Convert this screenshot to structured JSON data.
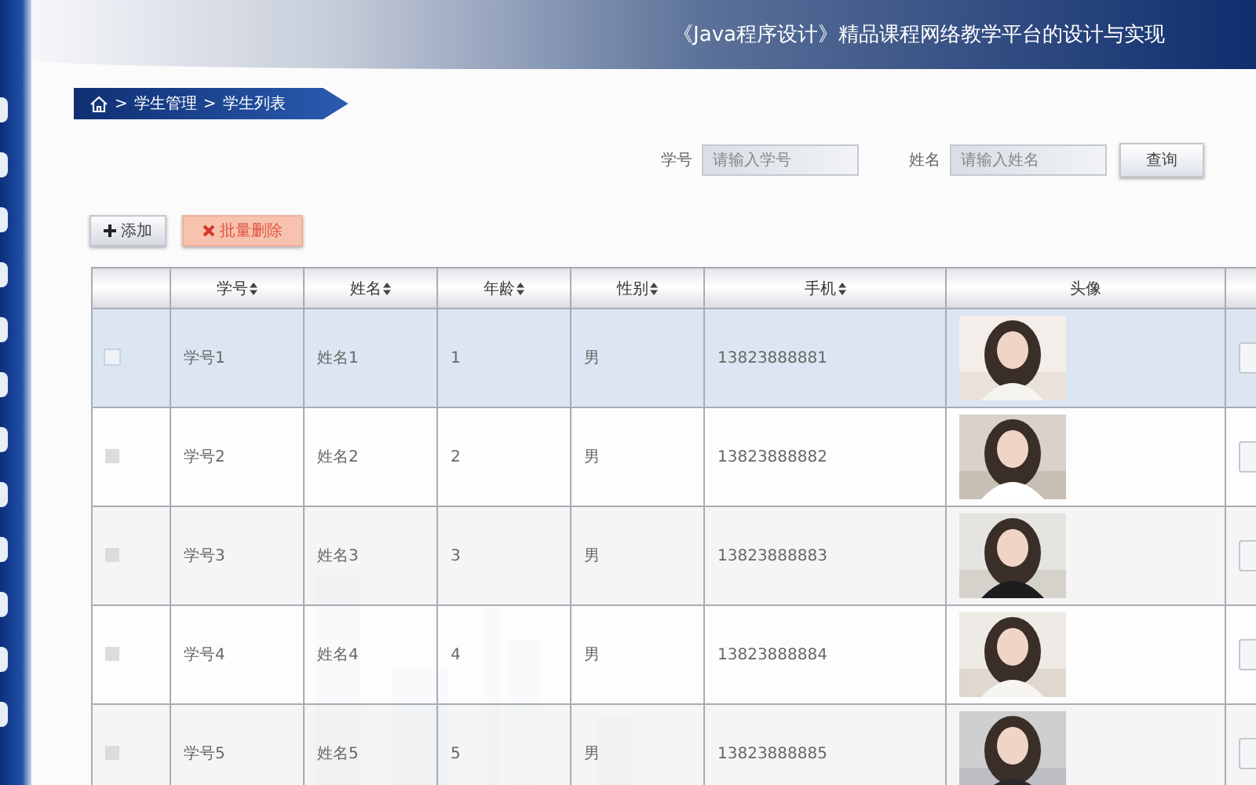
{
  "header": {
    "title": "《Java程序设计》精品课程网络教学平台的设计与实现"
  },
  "sidebar": {
    "tabs": [
      {
        "selected": false
      },
      {
        "selected": false
      },
      {
        "selected": false
      },
      {
        "selected": false
      },
      {
        "selected": false
      },
      {
        "selected": false
      },
      {
        "selected": false
      },
      {
        "selected": false
      },
      {
        "selected": false
      },
      {
        "selected": false
      },
      {
        "selected": false
      },
      {
        "selected": false
      }
    ]
  },
  "breadcrumb": [
    {
      "separator": ">",
      "label": "学生管理"
    },
    {
      "separator": ">",
      "label": "学生列表"
    }
  ],
  "search": {
    "fields": [
      {
        "label": "学号",
        "placeholder": "请输入学号"
      },
      {
        "label": "姓名",
        "placeholder": "请输入姓名"
      }
    ],
    "button": "查询"
  },
  "toolbar": [
    {
      "kind": "add",
      "label": "添加"
    },
    {
      "kind": "delete",
      "label": "批量删除"
    }
  ],
  "table": {
    "columns": [
      {
        "kind": "check"
      },
      {
        "kind": "text",
        "label": "学号",
        "sortable": true
      },
      {
        "kind": "text",
        "label": "姓名",
        "sortable": true
      },
      {
        "kind": "text",
        "label": "年龄",
        "sortable": true
      },
      {
        "kind": "text",
        "label": "性别",
        "sortable": true
      },
      {
        "kind": "text",
        "label": "手机",
        "sortable": true
      },
      {
        "kind": "picture",
        "label": "头像",
        "sortable": false
      },
      {
        "kind": "action"
      }
    ],
    "rows": [
      {
        "selected": true,
        "checked": false,
        "cells": [
          "",
          "学号1",
          "姓名1",
          "1",
          "男",
          "13823888881",
          "",
          ""
        ]
      },
      {
        "selected": false,
        "checked": false,
        "cells": [
          "",
          "学号2",
          "姓名2",
          "2",
          "男",
          "13823888882",
          "",
          ""
        ]
      },
      {
        "selected": false,
        "checked": false,
        "cells": [
          "",
          "学号3",
          "姓名3",
          "3",
          "男",
          "13823888883",
          "",
          ""
        ]
      },
      {
        "selected": false,
        "checked": false,
        "cells": [
          "",
          "学号4",
          "姓名4",
          "4",
          "男",
          "13823888884",
          "",
          ""
        ]
      },
      {
        "selected": false,
        "checked": false,
        "cells": [
          "",
          "学号5",
          "姓名5",
          "5",
          "男",
          "13823888885",
          "",
          ""
        ]
      }
    ]
  }
}
